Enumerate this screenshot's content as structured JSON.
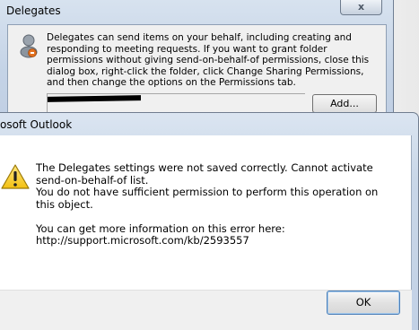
{
  "delegates_dialog": {
    "title": "Delegates",
    "close_label": "x",
    "description": "Delegates can send items on your behalf, including creating and responding to meeting requests. If you want to grant folder permissions without giving send-on-behalf-of permissions, close this dialog box, right-click the folder, click Change Sharing Permissions, and then change the options on the Permissions tab.",
    "add_button_label": "Add...",
    "icon": "delegate-user-icon"
  },
  "error_dialog": {
    "title": "osoft Outlook",
    "icon": "warning-icon",
    "message_line_1": "The Delegates settings were not saved correctly.  Cannot activate send-on-behalf-of list.",
    "message_line_2": "You do not have sufficient permission to perform this operation on this object.",
    "message_line_3": "You can get more information on this error here:",
    "message_link": "http://support.microsoft.com/kb/2593557",
    "ok_button_label": "OK"
  }
}
